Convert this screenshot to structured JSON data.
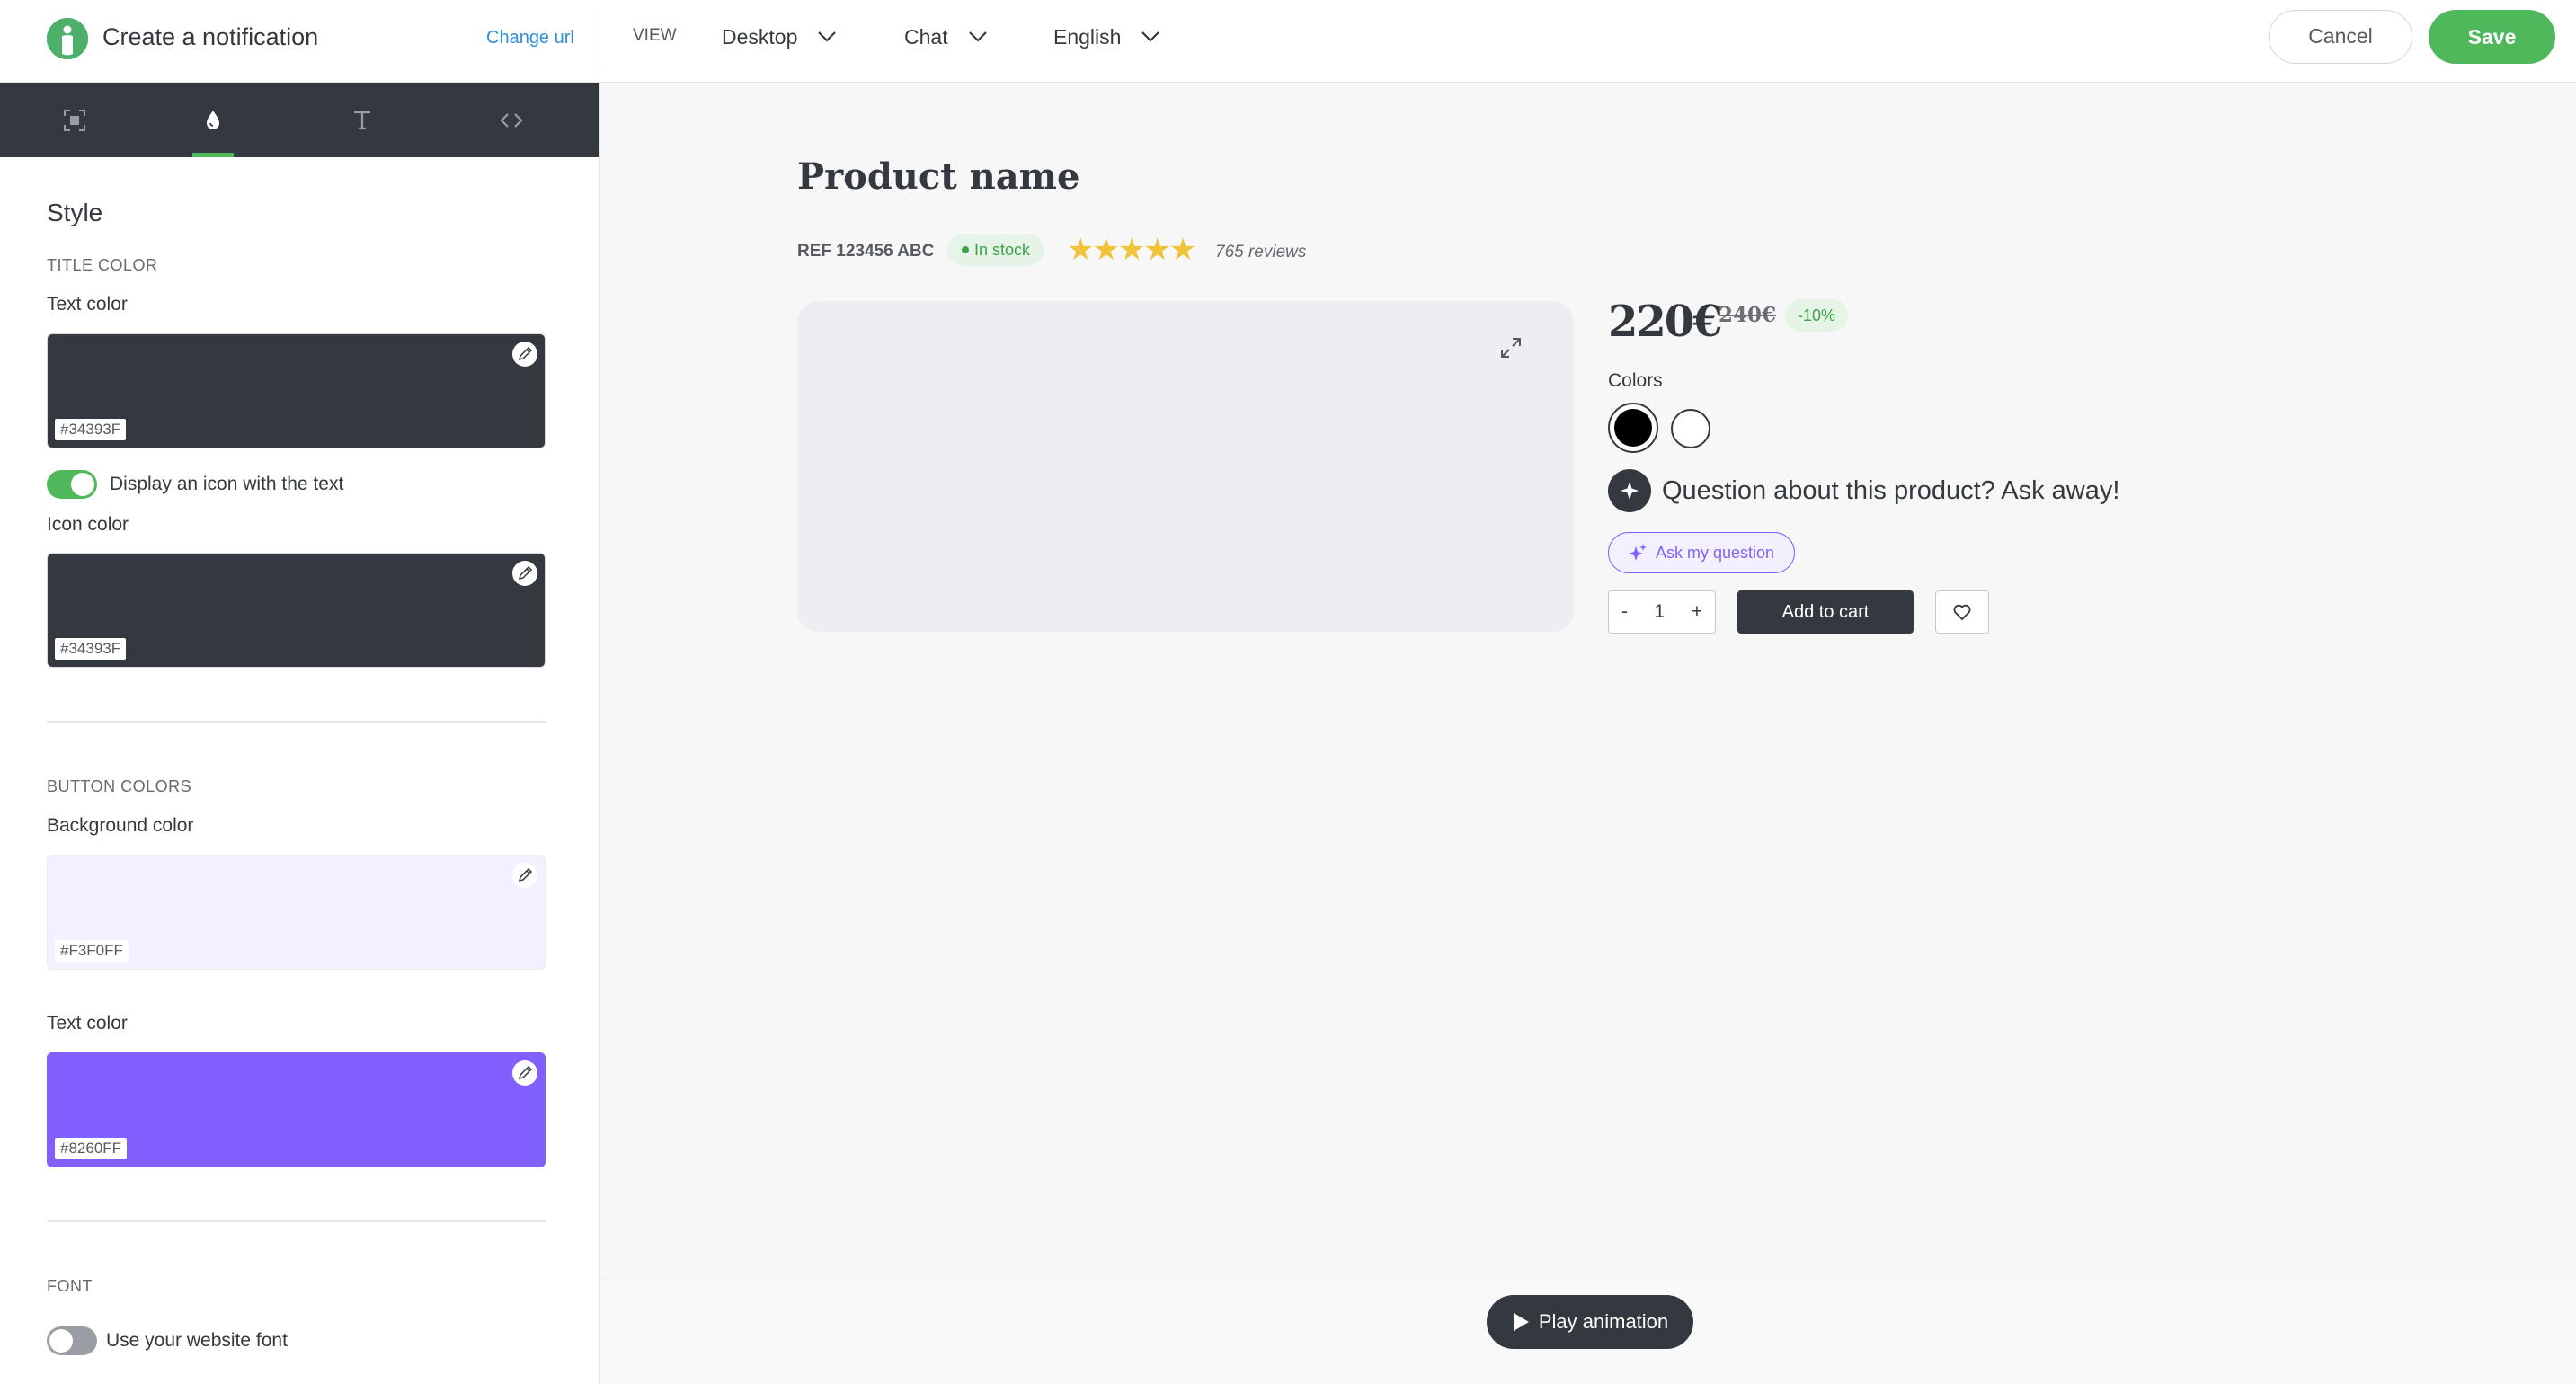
{
  "header": {
    "title": "Create a notification",
    "change_url": "Change url",
    "view_label": "VIEW",
    "device": "Desktop",
    "format": "Chat",
    "language": "English",
    "cancel": "Cancel",
    "save": "Save"
  },
  "sidebar": {
    "tabs": [
      {
        "name": "layout",
        "icon": "frame-icon"
      },
      {
        "name": "style",
        "icon": "drop-icon",
        "active": true
      },
      {
        "name": "text",
        "icon": "text-icon"
      },
      {
        "name": "code",
        "icon": "code-icon"
      }
    ],
    "heading": "Style",
    "title_color": {
      "caption": "TITLE COLOR",
      "text_color_label": "Text color",
      "text_color": "#34393F",
      "icon_toggle_label": "Display an icon with the text",
      "icon_toggle_on": true,
      "icon_color_label": "Icon color",
      "icon_color": "#34393F"
    },
    "button_colors": {
      "caption": "BUTTON COLORS",
      "bg_label": "Background color",
      "bg_color": "#F3F0FF",
      "text_label": "Text color",
      "text_color": "#8260FF"
    },
    "font": {
      "caption": "FONT",
      "toggle_label": "Use your website font",
      "toggle_on": false
    }
  },
  "preview": {
    "product_name": "Product name",
    "ref": "REF 123456 ABC",
    "stock": "In stock",
    "stars": "★★★★★",
    "rating": 5,
    "reviews": "765 reviews",
    "price": "220€",
    "old_price": "240€",
    "discount": "-10%",
    "colors_label": "Colors",
    "color_options": [
      "#000000",
      "#FFFFFF"
    ],
    "question": "Question about this product? Ask away!",
    "ask_button": "Ask my question",
    "qty_minus": "-",
    "qty_value": "1",
    "qty_plus": "+",
    "add_to_cart": "Add to cart",
    "play_animation": "Play animation"
  },
  "colors": {
    "accent_green": "#4EB85B",
    "dark": "#34393F",
    "purple": "#8260FF",
    "link_blue": "#2F8FD8"
  }
}
